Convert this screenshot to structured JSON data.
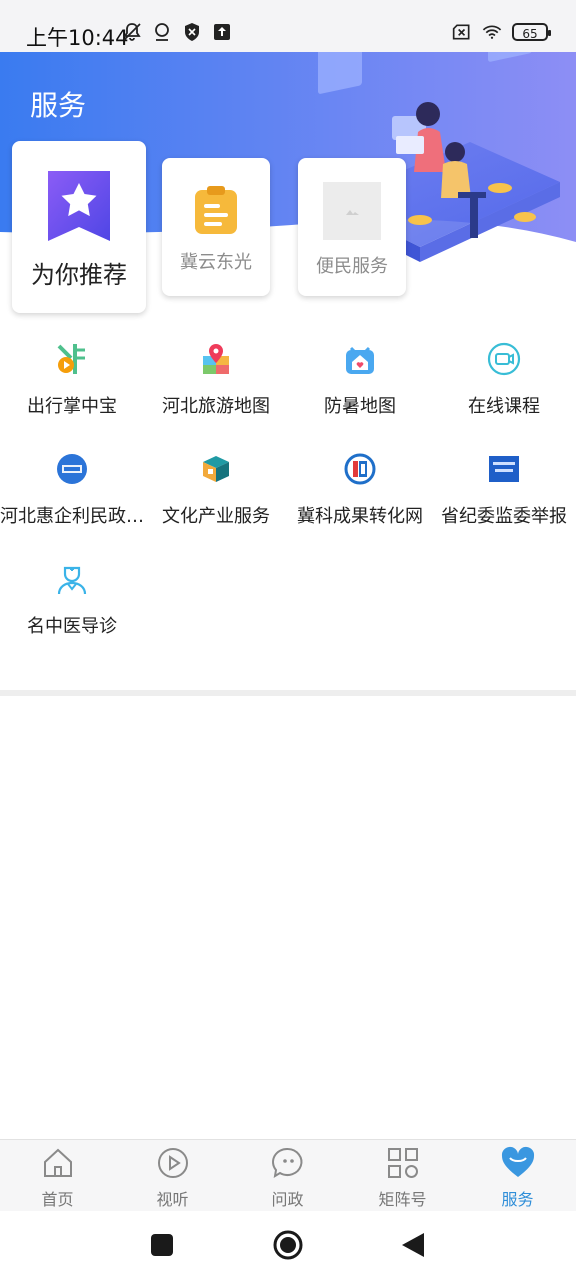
{
  "status_bar": {
    "time": "上午10:44",
    "battery": "65"
  },
  "header": {
    "title": "服务"
  },
  "top_cards": [
    {
      "label": "为你推荐"
    },
    {
      "label": "冀云东光"
    },
    {
      "label": "便民服务"
    }
  ],
  "services": [
    {
      "label": "出行掌中宝"
    },
    {
      "label": "河北旅游地图"
    },
    {
      "label": "防暑地图"
    },
    {
      "label": "在线课程"
    },
    {
      "label": "河北惠企利民政策通"
    },
    {
      "label": "文化产业服务"
    },
    {
      "label": "冀科成果转化网"
    },
    {
      "label": "省纪委监委举报"
    },
    {
      "label": "名中医导诊"
    }
  ],
  "bottom_nav": [
    {
      "label": "首页",
      "icon": "home-icon"
    },
    {
      "label": "视听",
      "icon": "play-icon"
    },
    {
      "label": "问政",
      "icon": "chat-icon"
    },
    {
      "label": "矩阵号",
      "icon": "grid-icon"
    },
    {
      "label": "服务",
      "icon": "heart-icon",
      "active": true
    }
  ],
  "colors": {
    "accent": "#2f8ed8",
    "header_start": "#3a7bf0",
    "header_end": "#8d8ef5"
  }
}
